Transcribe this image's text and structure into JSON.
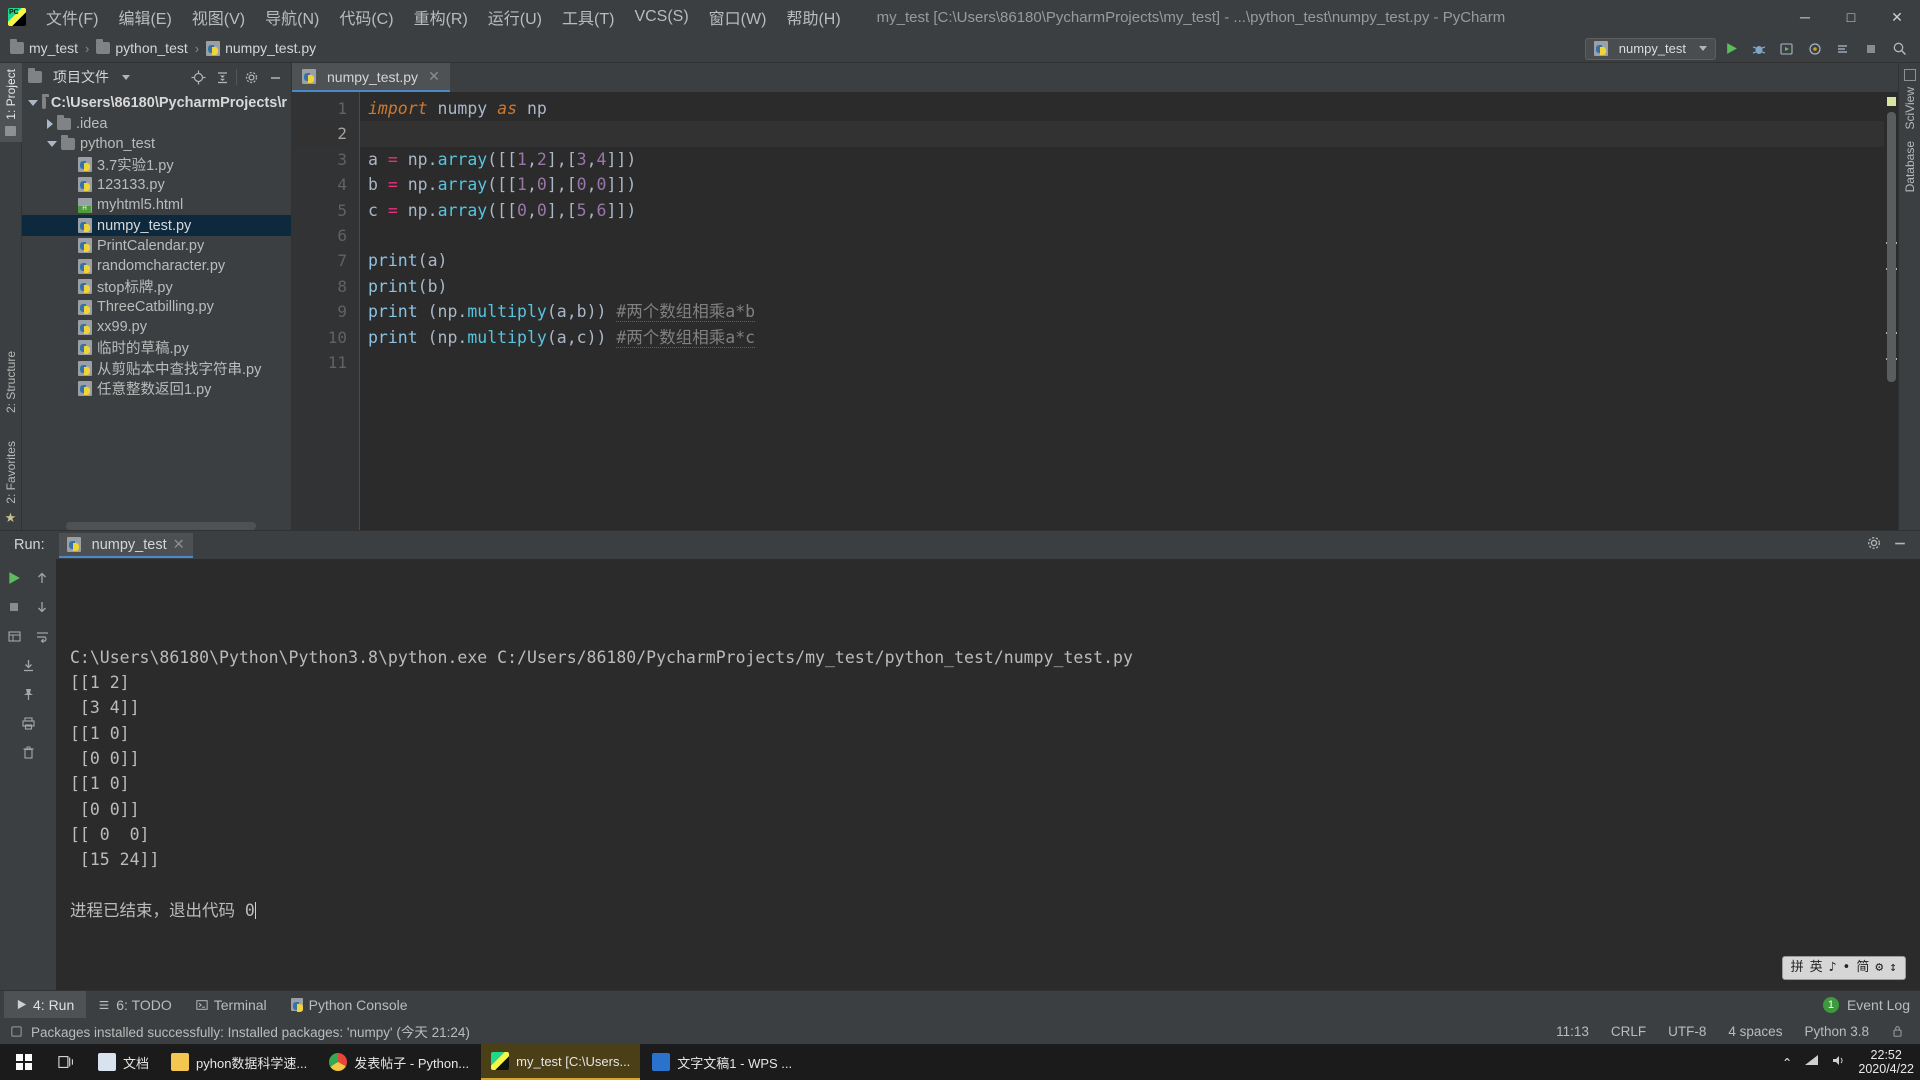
{
  "window": {
    "title": "my_test [C:\\Users\\86180\\PycharmProjects\\my_test] - ...\\python_test\\numpy_test.py - PyCharm",
    "minimize": "─",
    "maximize": "□",
    "close": "✕"
  },
  "menu": {
    "items": [
      {
        "label": "文件(F)"
      },
      {
        "label": "编辑(E)"
      },
      {
        "label": "视图(V)"
      },
      {
        "label": "导航(N)"
      },
      {
        "label": "代码(C)"
      },
      {
        "label": "重构(R)"
      },
      {
        "label": "运行(U)"
      },
      {
        "label": "工具(T)"
      },
      {
        "label": "VCS(S)"
      },
      {
        "label": "窗口(W)"
      },
      {
        "label": "帮助(H)"
      }
    ]
  },
  "breadcrumb": {
    "items": [
      {
        "label": "my_test",
        "icon": "folder-icon"
      },
      {
        "label": "python_test",
        "icon": "folder-icon"
      },
      {
        "label": "numpy_test.py",
        "icon": "python-file-icon"
      }
    ],
    "separator": "›"
  },
  "toolbar": {
    "run_config": "numpy_test",
    "run_button": "▶",
    "debug_button": "🐞",
    "coverage_button": "▶",
    "profile_button": "◉",
    "attach_button": "≡",
    "stop_button": "■",
    "search_button": "🔍"
  },
  "left_strip": {
    "project_label": "1: Project",
    "structure_label": "2: Structure",
    "favorites_label": "2: Favorites"
  },
  "right_strip": {
    "sciview_label": "SciView",
    "database_label": "Database"
  },
  "project_panel": {
    "title": "项目文件",
    "locate_icon": "crosshair-icon",
    "collapse_icon": "collapse-all-icon",
    "settings_icon": "gear-icon",
    "hide_icon": "minimize-icon",
    "tree": [
      {
        "label": "C:\\Users\\86180\\PycharmProjects\\r",
        "icon": "folder-icon",
        "indent": 0,
        "twisty": "open",
        "selected": false,
        "root": true
      },
      {
        "label": ".idea",
        "icon": "folder-icon",
        "indent": 1,
        "twisty": "closed",
        "selected": false,
        "root": false
      },
      {
        "label": "python_test",
        "icon": "folder-icon",
        "indent": 1,
        "twisty": "open",
        "selected": false,
        "root": false
      },
      {
        "label": "3.7实验1.py",
        "icon": "python-file-icon",
        "indent": 2,
        "twisty": "none",
        "selected": false,
        "root": false
      },
      {
        "label": "123133.py",
        "icon": "python-file-icon",
        "indent": 2,
        "twisty": "none",
        "selected": false,
        "root": false
      },
      {
        "label": "myhtml5.html",
        "icon": "html-file-icon",
        "indent": 2,
        "twisty": "none",
        "selected": false,
        "root": false
      },
      {
        "label": "numpy_test.py",
        "icon": "python-file-icon",
        "indent": 2,
        "twisty": "none",
        "selected": true,
        "root": false
      },
      {
        "label": "PrintCalendar.py",
        "icon": "python-file-icon",
        "indent": 2,
        "twisty": "none",
        "selected": false,
        "root": false
      },
      {
        "label": "randomcharacter.py",
        "icon": "python-file-icon",
        "indent": 2,
        "twisty": "none",
        "selected": false,
        "root": false
      },
      {
        "label": "stop标牌.py",
        "icon": "python-file-icon",
        "indent": 2,
        "twisty": "none",
        "selected": false,
        "root": false
      },
      {
        "label": "ThreeCatbilling.py",
        "icon": "python-file-icon",
        "indent": 2,
        "twisty": "none",
        "selected": false,
        "root": false
      },
      {
        "label": "xx99.py",
        "icon": "python-file-icon",
        "indent": 2,
        "twisty": "none",
        "selected": false,
        "root": false
      },
      {
        "label": "临时的草稿.py",
        "icon": "python-file-icon",
        "indent": 2,
        "twisty": "none",
        "selected": false,
        "root": false
      },
      {
        "label": "从剪贴本中查找字符串.py",
        "icon": "python-file-icon",
        "indent": 2,
        "twisty": "none",
        "selected": false,
        "root": false
      },
      {
        "label": "任意整数返回1.py",
        "icon": "python-file-icon",
        "indent": 2,
        "twisty": "none",
        "selected": false,
        "root": false
      }
    ]
  },
  "editor": {
    "tab": {
      "label": "numpy_test.py",
      "close": "✕"
    },
    "line_numbers": [
      "1",
      "2",
      "3",
      "4",
      "5",
      "6",
      "7",
      "8",
      "9",
      "10",
      "11"
    ],
    "current_line": 2,
    "lines": [
      {
        "n": 1,
        "tokens": [
          {
            "t": "import",
            "c": "kw"
          },
          {
            "t": " numpy ",
            "c": "txt"
          },
          {
            "t": "as",
            "c": "kw"
          },
          {
            "t": " np",
            "c": "txt"
          }
        ]
      },
      {
        "n": 2,
        "tokens": []
      },
      {
        "n": 3,
        "tokens": [
          {
            "t": "a ",
            "c": "txt"
          },
          {
            "t": "=",
            "c": "op"
          },
          {
            "t": " np.",
            "c": "txt"
          },
          {
            "t": "array",
            "c": "meth"
          },
          {
            "t": "([[",
            "c": "txt"
          },
          {
            "t": "1",
            "c": "num"
          },
          {
            "t": ",",
            "c": "txt"
          },
          {
            "t": "2",
            "c": "num"
          },
          {
            "t": "],[",
            "c": "txt"
          },
          {
            "t": "3",
            "c": "num"
          },
          {
            "t": ",",
            "c": "txt"
          },
          {
            "t": "4",
            "c": "num"
          },
          {
            "t": "]])",
            "c": "txt"
          }
        ]
      },
      {
        "n": 4,
        "tokens": [
          {
            "t": "b ",
            "c": "txt"
          },
          {
            "t": "=",
            "c": "op"
          },
          {
            "t": " np.",
            "c": "txt"
          },
          {
            "t": "array",
            "c": "meth"
          },
          {
            "t": "([[",
            "c": "txt"
          },
          {
            "t": "1",
            "c": "num"
          },
          {
            "t": ",",
            "c": "txt"
          },
          {
            "t": "0",
            "c": "num"
          },
          {
            "t": "],[",
            "c": "txt"
          },
          {
            "t": "0",
            "c": "num"
          },
          {
            "t": ",",
            "c": "txt"
          },
          {
            "t": "0",
            "c": "num"
          },
          {
            "t": "]])",
            "c": "txt"
          }
        ]
      },
      {
        "n": 5,
        "tokens": [
          {
            "t": "c ",
            "c": "txt"
          },
          {
            "t": "=",
            "c": "op"
          },
          {
            "t": " np.",
            "c": "txt"
          },
          {
            "t": "array",
            "c": "meth"
          },
          {
            "t": "([[",
            "c": "txt"
          },
          {
            "t": "0",
            "c": "num"
          },
          {
            "t": ",",
            "c": "txt"
          },
          {
            "t": "0",
            "c": "num"
          },
          {
            "t": "],[",
            "c": "txt"
          },
          {
            "t": "5",
            "c": "num"
          },
          {
            "t": ",",
            "c": "txt"
          },
          {
            "t": "6",
            "c": "num"
          },
          {
            "t": "]])",
            "c": "txt"
          }
        ]
      },
      {
        "n": 6,
        "tokens": []
      },
      {
        "n": 7,
        "tokens": [
          {
            "t": "print",
            "c": "fn"
          },
          {
            "t": "(a)",
            "c": "txt"
          }
        ]
      },
      {
        "n": 8,
        "tokens": [
          {
            "t": "print",
            "c": "fn"
          },
          {
            "t": "(b)",
            "c": "txt"
          }
        ]
      },
      {
        "n": 9,
        "tokens": [
          {
            "t": "print",
            "c": "fn"
          },
          {
            "t": " (np.",
            "c": "txt"
          },
          {
            "t": "multiply",
            "c": "meth"
          },
          {
            "t": "(a,b)) ",
            "c": "txt"
          },
          {
            "t": "#两个数组相乘a*b",
            "c": "cmt"
          }
        ]
      },
      {
        "n": 10,
        "tokens": [
          {
            "t": "print",
            "c": "fn"
          },
          {
            "t": " (np.",
            "c": "txt"
          },
          {
            "t": "multiply",
            "c": "meth"
          },
          {
            "t": "(a,c)) ",
            "c": "txt"
          },
          {
            "t": "#两个数组相乘a*c",
            "c": "cmt"
          }
        ]
      },
      {
        "n": 11,
        "tokens": []
      }
    ]
  },
  "run_panel": {
    "label": "Run:",
    "tab": "numpy_test",
    "tab_close": "✕",
    "settings_icon": "gear-icon",
    "hide_icon": "minimize-icon",
    "toolbar_icons": [
      "rerun-icon",
      "scroll-up-icon",
      "stop-icon",
      "scroll-down-icon",
      "print-layout-icon",
      "soft-wrap-icon",
      "export-icon",
      "pin-icon",
      "printer-icon",
      "trash-icon"
    ],
    "console_lines": [
      "C:\\Users\\86180\\Python\\Python3.8\\python.exe C:/Users/86180/PycharmProjects/my_test/python_test/numpy_test.py",
      "[[1 2]",
      " [3 4]]",
      "[[1 0]",
      " [0 0]]",
      "[[1 0]",
      " [0 0]]",
      "[[ 0  0]",
      " [15 24]]",
      "",
      "进程已结束，退出代码 0"
    ]
  },
  "ime": {
    "items": [
      "拼",
      "英",
      "♪",
      "•",
      "简",
      "⚙",
      "↕"
    ]
  },
  "bottom_bar": {
    "items": [
      {
        "label": "4: Run",
        "icon": "play-icon",
        "active": true
      },
      {
        "label": "6: TODO",
        "icon": "list-icon",
        "active": false
      },
      {
        "label": "Terminal",
        "icon": "terminal-icon",
        "active": false
      },
      {
        "label": "Python Console",
        "icon": "python-icon",
        "active": false
      }
    ],
    "event_log": {
      "label": "Event Log",
      "count": "1"
    }
  },
  "status_bar": {
    "message": "Packages installed successfully: Installed packages: 'numpy' (今天 21:24)",
    "caret_position": "11:13",
    "line_separator": "CRLF",
    "encoding": "UTF-8",
    "indent": "4 spaces",
    "interpreter": "Python 3.8",
    "lock_icon": "lock-icon"
  },
  "taskbar": {
    "start": "windows-logo",
    "task_view": "task-view-icon",
    "buttons": [
      {
        "label": "文档",
        "color": "#d8e3ef",
        "active": false
      },
      {
        "label": "pyhon数据科学速...",
        "color": "#f3c74f",
        "active": false
      },
      {
        "label": "发表帖子 - Python...",
        "color": "#e8453c",
        "active": false
      },
      {
        "label": "my_test [C:\\Users...",
        "color": "#21d789",
        "active": true
      },
      {
        "label": "文字文稿1 - WPS ...",
        "color": "#2a72cc",
        "active": false
      }
    ],
    "tray": {
      "chevron": "⌃",
      "network": "📶",
      "volume": "🔊"
    },
    "clock_time": "22:52",
    "clock_date": "2020/4/22"
  }
}
